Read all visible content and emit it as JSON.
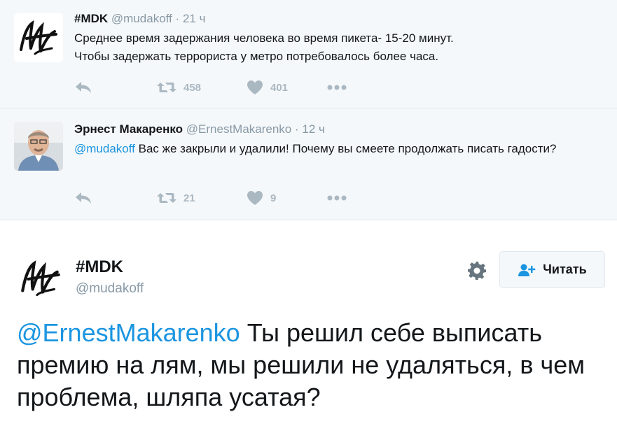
{
  "thread": {
    "tweets": [
      {
        "fullname": "#MDK",
        "username": "@mudakoff",
        "dot": "·",
        "time": "21 ч",
        "text_line1": "Среднее время задержания человека во время пикета- 15-20 минут.",
        "text_line2": "Чтобы задержать террориста у метро потребовалось более часа.",
        "retweets": "458",
        "likes": "401",
        "avatar_icon": "mdk-logo"
      },
      {
        "fullname": "Эрнест Макаренко",
        "username": "@ErnestMakarenko",
        "dot": "·",
        "time": "12 ч",
        "mention": "@mudakoff",
        "text_rest": " Вас же закрыли и удалили! Почему вы смеете продолжать писать гадости?",
        "retweets": "21",
        "likes": "9",
        "avatar_icon": "person-photo"
      }
    ]
  },
  "main_tweet": {
    "fullname": "#MDK",
    "username": "@mudakoff",
    "follow_label": "Читать",
    "mention": "@ErnestMakarenko",
    "text_rest": " Ты решил себе выписать премию на лям, мы решили не удаляться, в чем проблема, шляпа усатая?",
    "avatar_icon": "mdk-logo"
  },
  "colors": {
    "accent": "#1b95e0",
    "muted": "#8899a6",
    "action": "#aab8c2",
    "thread_bg": "#f5f8fa"
  }
}
